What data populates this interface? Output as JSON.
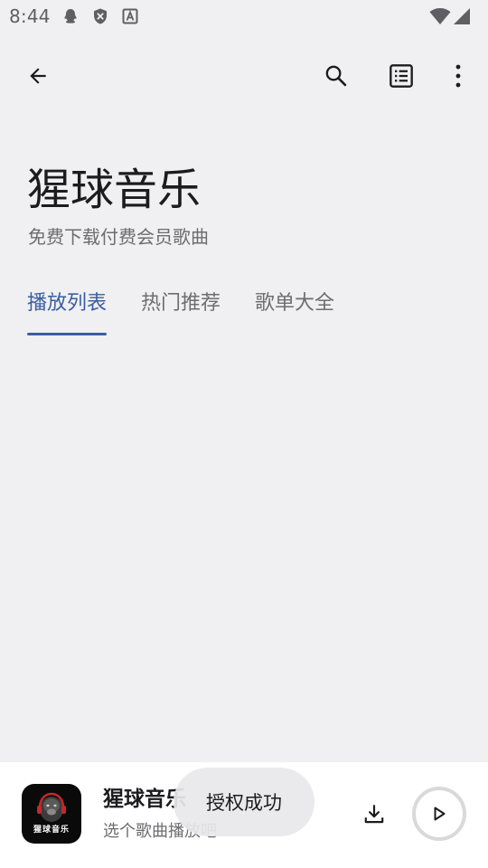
{
  "status_bar": {
    "time": "8:44",
    "icons": [
      "qq-notification-icon",
      "shield-x-icon",
      "app-a-icon",
      "wifi-icon",
      "cell-signal-icon"
    ]
  },
  "app_bar": {
    "icons": [
      "back-arrow-icon",
      "search-icon",
      "list-icon",
      "more-vert-icon"
    ]
  },
  "header": {
    "title": "猩球音乐",
    "subtitle": "免费下载付费会员歌曲"
  },
  "tabs": [
    {
      "label": "播放列表",
      "active": true
    },
    {
      "label": "热门推荐",
      "active": false
    },
    {
      "label": "歌单大全",
      "active": false
    }
  ],
  "player": {
    "album_caption": "猩球音乐",
    "title": "猩球音乐",
    "subtitle": "选个歌曲播放吧",
    "icons": [
      "download-icon",
      "play-icon"
    ]
  },
  "toast": {
    "message": "授权成功"
  },
  "colors": {
    "background": "#f0eff1",
    "accent": "#3a5f9f",
    "player_background": "#ffffff",
    "toast_background": "#e8e8eb"
  }
}
